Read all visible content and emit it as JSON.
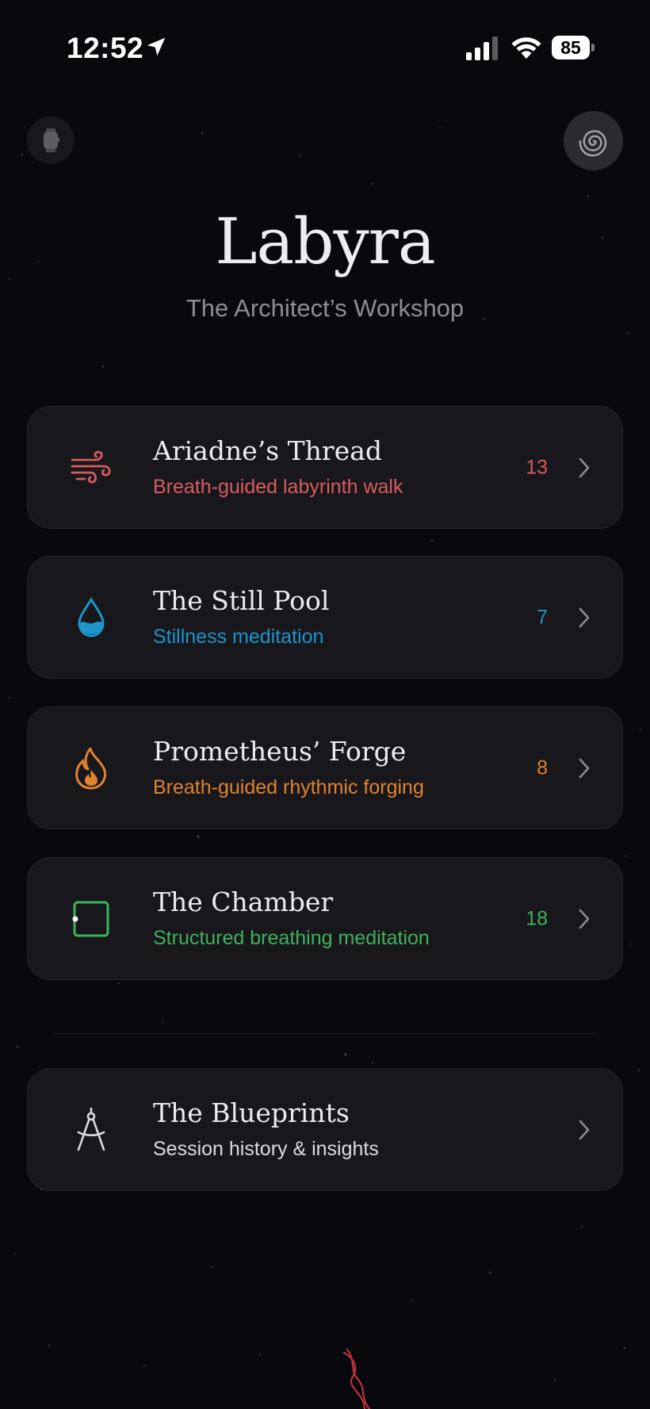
{
  "status_bar": {
    "time": "12:52",
    "battery": "85"
  },
  "header": {
    "title": "Labyra",
    "subtitle": "The Architect’s Workshop"
  },
  "icons": {
    "watch": "watch-icon",
    "spiral": "spiral-icon",
    "wind": "wind-icon",
    "drop": "water-drop-icon",
    "flame": "flame-icon",
    "square": "square-icon",
    "compass": "drafting-compass-icon",
    "chevron": "chevron-right-icon"
  },
  "colors": {
    "thread": "#d85c5e",
    "pool": "#1e94c9",
    "forge": "#e0832f",
    "chamber": "#3fb25b",
    "blueprints": "#dcdce0",
    "chevron": "#8a8a90"
  },
  "practices": [
    {
      "title": "Ariadne’s Thread",
      "subtitle": "Breath-guided labyrinth walk",
      "count": "13"
    },
    {
      "title": "The Still Pool",
      "subtitle": "Stillness meditation",
      "count": "7"
    },
    {
      "title": "Prometheus’ Forge",
      "subtitle": "Breath-guided rhythmic forging",
      "count": "8"
    },
    {
      "title": "The Chamber",
      "subtitle": "Structured breathing meditation",
      "count": "18"
    }
  ],
  "blueprints": {
    "title": "The Blueprints",
    "subtitle": "Session history & insights"
  }
}
